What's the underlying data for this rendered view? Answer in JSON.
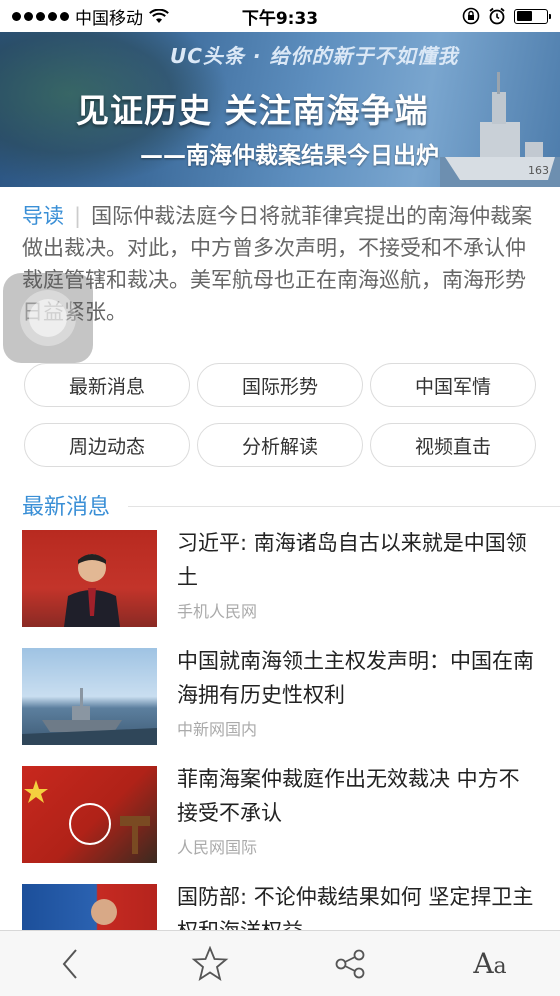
{
  "status_bar": {
    "carrier": "中国移动",
    "time": "下午9:33",
    "signal_bars": 5,
    "battery_level": 0.55
  },
  "banner": {
    "brand_text": "UC头条 · 给你的新于不如懂我",
    "title": "见证历史 关注南海争端",
    "subtitle": "——南海仲裁案结果今日出炉"
  },
  "intro": {
    "tag": "导读",
    "text": "国际仲裁法庭今日将就菲律宾提出的南海仲裁案做出裁决。对此，中方曾多次声明，不接受和不承认仲裁庭管辖和裁决。美军航母也正在南海巡航，南海形势日益紧张。"
  },
  "categories": [
    "最新消息",
    "国际形势",
    "中国军情",
    "周边动态",
    "分析解读",
    "视频直击"
  ],
  "section": {
    "title": "最新消息"
  },
  "news": [
    {
      "headline": "习近平: 南海诸岛自古以来就是中国领土",
      "source": "手机人民网"
    },
    {
      "headline": "中国就南海领土主权发声明：中国在南海拥有历史性权利",
      "source": "中新网国内"
    },
    {
      "headline": "菲南海案仲裁庭作出无效裁决 中方不接受不承认",
      "source": "人民网国际"
    },
    {
      "headline": "国防部: 不论仲裁结果如何 坚定捍卫主权和海洋权益",
      "source": ""
    }
  ],
  "toolbar": {
    "font_label": "A",
    "font_label_small": "a",
    "icons": [
      "back-icon",
      "star-icon",
      "share-icon",
      "font-size-icon"
    ]
  },
  "colors": {
    "accent": "#3a8fd6",
    "banner_blue": "#3f6e9e"
  }
}
